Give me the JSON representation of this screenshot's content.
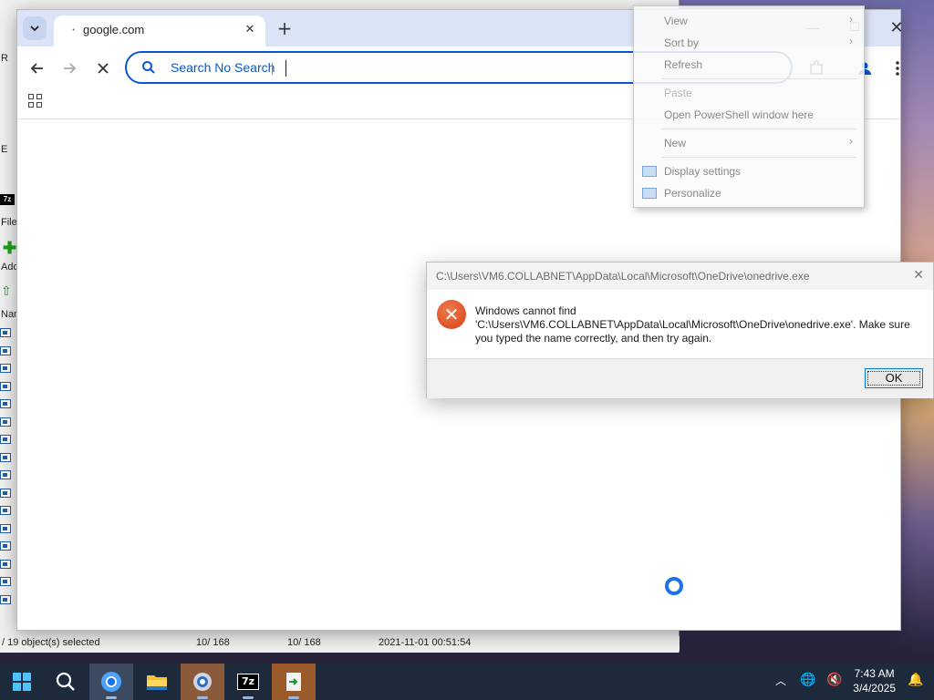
{
  "background_window": {
    "side_labels": [
      "R",
      "E",
      "File",
      "Add",
      "Nam"
    ],
    "status": {
      "selection": "/ 19 object(s) selected",
      "size": "10/ 168",
      "packed": "10/ 168",
      "modified": "2021-11-01 00:51:54"
    }
  },
  "browser": {
    "tab": {
      "title": "google.com",
      "loading_mark": "ꞏ"
    },
    "omnibox": {
      "placeholder": "Search No Search"
    }
  },
  "context_menu": {
    "items": [
      {
        "label": "View",
        "submenu": true
      },
      {
        "label": "Sort by",
        "submenu": true
      },
      {
        "label": "Refresh",
        "submenu": false
      },
      {
        "label": "Paste",
        "submenu": false
      },
      {
        "label": "Open PowerShell window here",
        "submenu": false
      },
      {
        "label": "New",
        "submenu": true
      },
      {
        "label": "Display settings",
        "submenu": false
      },
      {
        "label": "Personalize",
        "submenu": false
      }
    ]
  },
  "dialog": {
    "title": "C:\\Users\\VM6.COLLABNET\\AppData\\Local\\Microsoft\\OneDrive\\onedrive.exe",
    "message_line1": "Windows cannot find",
    "message_line2": "'C:\\Users\\VM6.COLLABNET\\AppData\\Local\\Microsoft\\OneDrive\\onedrive.exe'. Make sure",
    "message_line3": "you typed the name correctly, and then try again.",
    "ok_label": "OK"
  },
  "taskbar": {
    "apps": [
      "start-icon",
      "search-icon",
      "chrome-icon",
      "file-explorer-icon",
      "settings-chrome-icon",
      "7zip-icon",
      "notepad-icon"
    ],
    "time": "7:43 AM",
    "date": "3/4/2025",
    "sevenzip_label": "7z"
  }
}
